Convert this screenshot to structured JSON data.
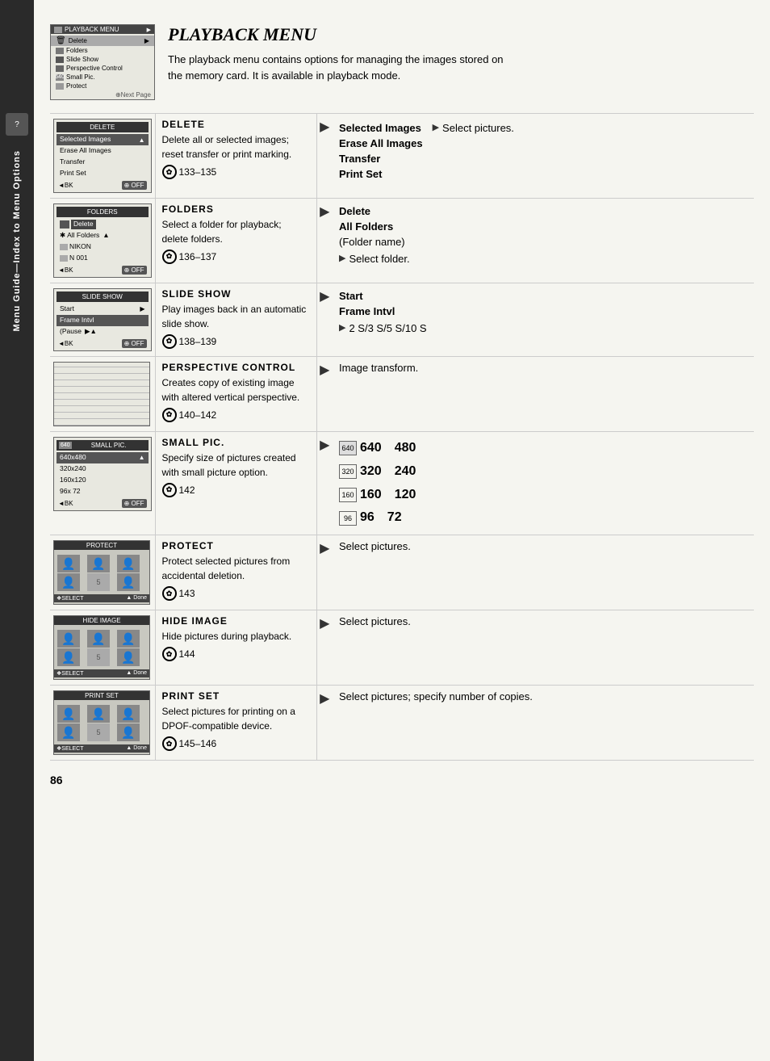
{
  "sidebar": {
    "label": "Menu Guide—Index to Menu Options"
  },
  "topScreen": {
    "title": "PLAYBACK MENU",
    "nextArrow": "▶",
    "items": [
      "Delete",
      "Folders",
      "Slide Show",
      "Perspective Control",
      "Small Pic.",
      "Protect"
    ],
    "nextPage": "⊕Next Page"
  },
  "page": {
    "title": "PLAYBACK MENU",
    "intro": "The playback menu contains options for managing the images stored on the memory card.  It is available in playback mode.",
    "number": "86"
  },
  "rows": [
    {
      "screenTitle": "DELETE",
      "screenItems": [
        "Selected Images",
        "Erase All Images",
        "Transfer",
        "Print Set"
      ],
      "screenFooter": [
        "◄BK",
        "⊕ OFF"
      ],
      "title": "DELETE",
      "desc": "Delete all or selected images; reset transfer or print marking.",
      "ref": "133–135",
      "options": [
        "Selected Images",
        "Erase All Images",
        "Transfer",
        "Print Set"
      ],
      "optionNote": "Select pictures."
    },
    {
      "screenTitle": "FOLDERS",
      "screenItems": [
        "Delete",
        "All Folders",
        "NIKON",
        "N 001"
      ],
      "screenFooter": [
        "◄BK",
        "⊕ OFF"
      ],
      "title": "FOLDERS",
      "desc": "Select a folder for playback; delete folders.",
      "ref": "136–137",
      "options": [
        "Delete",
        "All Folders",
        "(Folder name)"
      ],
      "optionNote": "Select folder."
    },
    {
      "screenTitle": "SLIDE SHOW",
      "screenItems": [
        "Start",
        "Frame Intvl",
        "(Pause"
      ],
      "screenFooter": [
        "◄BK",
        "⊕ OFF"
      ],
      "title": "SLIDE SHOW",
      "desc": "Play images back in an automatic slide show.",
      "ref": "138–139",
      "options": [
        "Start",
        "Frame Intvl"
      ],
      "optionNote": "2 S/3 S/5 S/10 S"
    },
    {
      "screenTitle": "PERSPECTIVE CONTROL",
      "screenItems": [],
      "screenFooter": [],
      "title": "PERSPECTIVE CONTROL",
      "desc": "Creates copy of existing image with altered vertical perspective.",
      "ref": "140–142",
      "optionNote": "Image transform."
    },
    {
      "screenTitle": "SMALL PIC.",
      "screenItems": [
        "640x480",
        "320x240",
        "160x120",
        "96x 72"
      ],
      "screenFooter": [
        "◄BK",
        "⊕ OFF"
      ],
      "title": "SMALL PIC.",
      "desc": "Specify size of pictures created with small picture option.",
      "ref": "142",
      "sizes": [
        {
          "label": "640",
          "w": "640",
          "h": "480"
        },
        {
          "label": "320",
          "w": "320",
          "h": "240"
        },
        {
          "label": "160",
          "w": "160",
          "h": "120"
        },
        {
          "label": "96",
          "w": "96",
          "h": "72"
        }
      ]
    },
    {
      "screenTitle": "PROTECT",
      "screenItems": [],
      "screenFooter": [
        "❖SELECT",
        "▲ Done"
      ],
      "title": "PROTECT",
      "desc": "Protect selected pictures from accidental deletion.",
      "ref": "143",
      "optionNote": "Select pictures."
    },
    {
      "screenTitle": "HIDE IMAGE",
      "screenItems": [],
      "screenFooter": [
        "❖SELECT",
        "▲ Done"
      ],
      "title": "HIDE IMAGE",
      "desc": "Hide pictures during playback.",
      "ref": "144",
      "optionNote": "Select pictures."
    },
    {
      "screenTitle": "PRINT SET",
      "screenItems": [],
      "screenFooter": [
        "❖SELECT",
        "▲ Done"
      ],
      "title": "PRINT SET",
      "desc": "Select pictures for printing on a DPOF-compatible device.",
      "ref": "145–146",
      "optionNote": "Select pictures; specify number of copies."
    }
  ]
}
